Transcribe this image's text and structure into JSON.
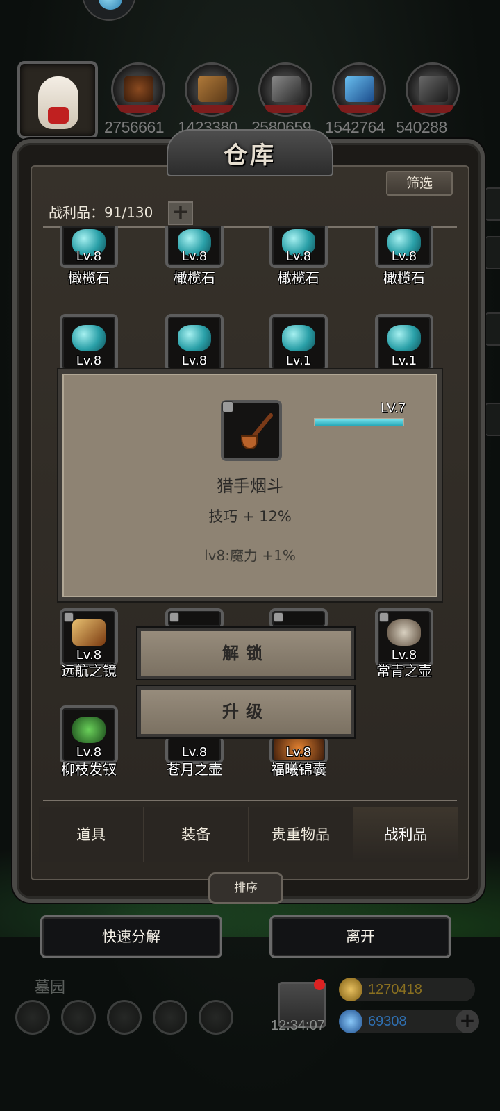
{
  "resources": [
    "2756661",
    "1423380",
    "2580659",
    "1542764",
    "540288"
  ],
  "warehouse": {
    "title": "仓库",
    "filter_label": "筛选",
    "loot_count_label": "战利品：91/130",
    "add_label": "+"
  },
  "grid": {
    "row1": [
      {
        "level": "Lv.8",
        "name": "橄榄石"
      },
      {
        "level": "Lv.8",
        "name": "橄榄石"
      },
      {
        "level": "Lv.8",
        "name": "橄榄石"
      },
      {
        "level": "Lv.8",
        "name": "橄榄石"
      }
    ],
    "row2": [
      {
        "level": "Lv.8"
      },
      {
        "level": "Lv.8"
      },
      {
        "level": "Lv.1"
      },
      {
        "level": "Lv.1"
      }
    ],
    "row3": [
      {
        "level": "Lv.8",
        "name": "远航之镜"
      },
      {
        "level": "Lv.8",
        "name": "常青之壶"
      }
    ],
    "row4": [
      {
        "level": "Lv.8",
        "name": "柳枝发钗"
      },
      {
        "level": "Lv.8",
        "name": "苍月之壶"
      },
      {
        "level": "Lv.8",
        "name": "福曦锦囊"
      }
    ]
  },
  "popup": {
    "level": "LV.7",
    "xp_fraction": 1.0,
    "item_name": "猎手烟斗",
    "stat": "技巧 + 12%",
    "bonus": "lv8:魔力 +1%",
    "unlock_label": "解锁",
    "upgrade_label": "升级"
  },
  "tabs": [
    {
      "label": "道具"
    },
    {
      "label": "装备"
    },
    {
      "label": "贵重物品"
    },
    {
      "label": "战利品",
      "active": true
    }
  ],
  "sort_label": "排序",
  "quick_decompose_label": "快速分解",
  "leave_label": "离开",
  "hud": {
    "area_name": "墓园",
    "clock": "12:34:07",
    "gold": "1270418",
    "gems": "69308",
    "add": "+"
  },
  "colors": {
    "gold_text": "#8a7020",
    "gem_text": "#2f6fb0",
    "accent_cyan": "#27a8b8"
  }
}
